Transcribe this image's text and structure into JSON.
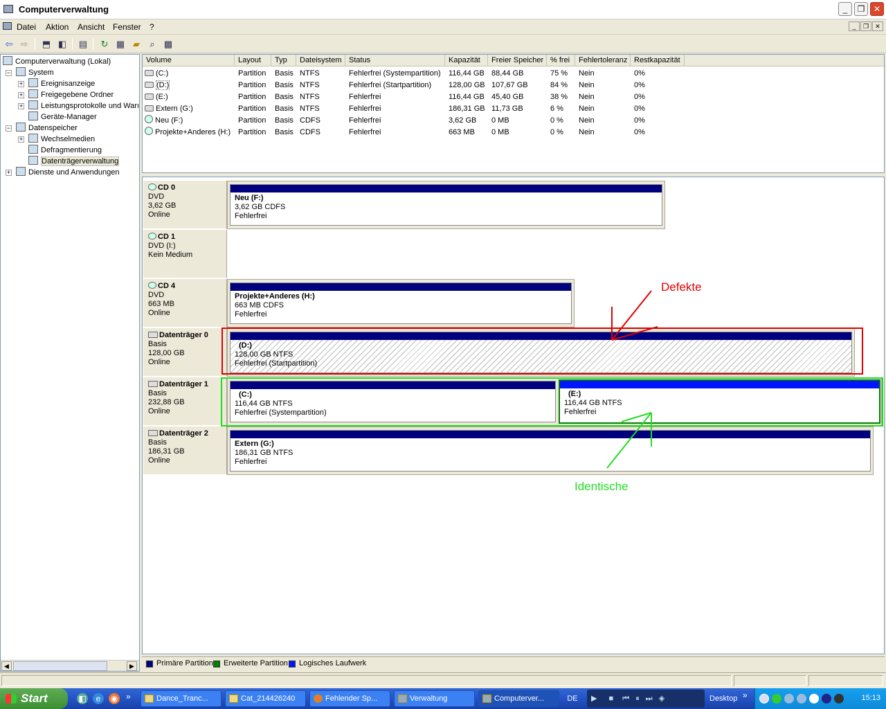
{
  "window": {
    "title": "Computerverwaltung",
    "min": "_",
    "max": "❐",
    "close": "✕"
  },
  "menu": [
    "Datei",
    "Aktion",
    "Ansicht",
    "Fenster",
    "?"
  ],
  "tree": {
    "root": "Computerverwaltung (Lokal)",
    "system": "System",
    "ereignis": "Ereignisanzeige",
    "freigegeben": "Freigegebene Ordner",
    "leistung": "Leistungsprotokolle und Warı",
    "geraete": "Geräte-Manager",
    "datenspeicher": "Datenspeicher",
    "wechsel": "Wechselmedien",
    "defrag": "Defragmentierung",
    "datentraeger": "Datenträgerverwaltung",
    "dienste": "Dienste und Anwendungen"
  },
  "list": {
    "columns": [
      "Volume",
      "Layout",
      "Typ",
      "Dateisystem",
      "Status",
      "Kapazität",
      "Freier Speicher",
      "% frei",
      "Fehlertoleranz",
      "Restkapazität"
    ],
    "rows": [
      {
        "volume": "(C:)",
        "layout": "Partition",
        "typ": "Basis",
        "fs": "NTFS",
        "status": "Fehlerfrei (Systempartition)",
        "kap": "116,44 GB",
        "frei": "88,44 GB",
        "pct": "75 %",
        "ft": "Nein",
        "rest": "0%",
        "icon": "hdd"
      },
      {
        "volume": "(D:)",
        "layout": "Partition",
        "typ": "Basis",
        "fs": "NTFS",
        "status": "Fehlerfrei (Startpartition)",
        "kap": "128,00 GB",
        "frei": "107,67 GB",
        "pct": "84 %",
        "ft": "Nein",
        "rest": "0%",
        "icon": "hdd"
      },
      {
        "volume": "(E:)",
        "layout": "Partition",
        "typ": "Basis",
        "fs": "NTFS",
        "status": "Fehlerfrei",
        "kap": "116,44 GB",
        "frei": "45,40 GB",
        "pct": "38 %",
        "ft": "Nein",
        "rest": "0%",
        "icon": "hdd"
      },
      {
        "volume": "Extern (G:)",
        "layout": "Partition",
        "typ": "Basis",
        "fs": "NTFS",
        "status": "Fehlerfrei",
        "kap": "186,31 GB",
        "frei": "11,73 GB",
        "pct": "6 %",
        "ft": "Nein",
        "rest": "0%",
        "icon": "hdd"
      },
      {
        "volume": "Neu (F:)",
        "layout": "Partition",
        "typ": "Basis",
        "fs": "CDFS",
        "status": "Fehlerfrei",
        "kap": "3,62 GB",
        "frei": "0 MB",
        "pct": "0 %",
        "ft": "Nein",
        "rest": "0%",
        "icon": "cd"
      },
      {
        "volume": "Projekte+Anderes (H:)",
        "layout": "Partition",
        "typ": "Basis",
        "fs": "CDFS",
        "status": "Fehlerfrei",
        "kap": "663 MB",
        "frei": "0 MB",
        "pct": "0 %",
        "ft": "Nein",
        "rest": "0%",
        "icon": "cd"
      }
    ]
  },
  "disks": [
    {
      "name": "CD 0",
      "l1": "DVD",
      "l2": "3,62 GB",
      "l3": "Online",
      "icon": "cd"
    },
    {
      "name": "CD 1",
      "l1": "DVD (I:)",
      "l2": "",
      "l3": "Kein Medium",
      "icon": "cd"
    },
    {
      "name": "CD 4",
      "l1": "DVD",
      "l2": "663 MB",
      "l3": "Online",
      "icon": "cd"
    },
    {
      "name": "Datenträger 0",
      "l1": "Basis",
      "l2": "128,00 GB",
      "l3": "Online",
      "icon": "hdd"
    },
    {
      "name": "Datenträger 1",
      "l1": "Basis",
      "l2": "232,88 GB",
      "l3": "Online",
      "icon": "hdd"
    },
    {
      "name": "Datenträger 2",
      "l1": "Basis",
      "l2": "186,31 GB",
      "l3": "Online",
      "icon": "hdd"
    }
  ],
  "partitions": {
    "f": {
      "name": "Neu  (F:)",
      "size": "3,62 GB CDFS",
      "status": "Fehlerfrei"
    },
    "h": {
      "name": "Projekte+Anderes  (H:)",
      "size": "663 MB CDFS",
      "status": "Fehlerfrei"
    },
    "d": {
      "name": "(D:)",
      "size": "128,00 GB NTFS",
      "status": "Fehlerfrei (Startpartition)"
    },
    "c": {
      "name": "(C:)",
      "size": "116,44 GB NTFS",
      "status": "Fehlerfrei (Systempartition)"
    },
    "e": {
      "name": "(E:)",
      "size": "116,44 GB NTFS",
      "status": "Fehlerfrei"
    },
    "g": {
      "name": "Extern  (G:)",
      "size": "186,31 GB NTFS",
      "status": "Fehlerfrei"
    }
  },
  "legend": {
    "primary": "Primäre Partition",
    "extended": "Erweiterte Partition",
    "logical": "Logisches Laufwerk",
    "c_primary": "#00007f",
    "c_extended": "#008000",
    "c_logical": "#0016ff"
  },
  "annotations": {
    "defekte": "Defekte",
    "identische": "Identische",
    "red": "#e00000",
    "green": "#22dd22"
  },
  "taskbar": {
    "start": "Start",
    "more": "»",
    "tasks": [
      "Dance_Tranc...",
      "Cat_214426240",
      "Fehlender Sp...",
      "Verwaltung",
      "Computerver..."
    ],
    "lang": "DE",
    "desktop": "Desktop",
    "clock": "15:13"
  }
}
